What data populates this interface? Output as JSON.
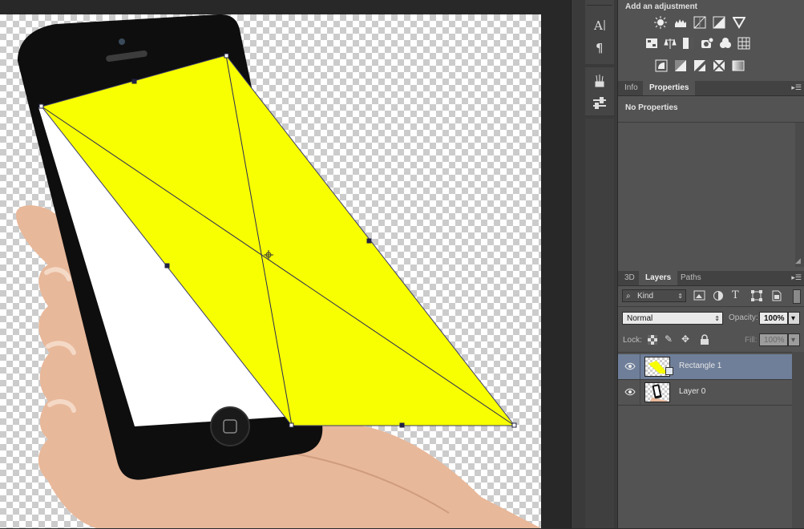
{
  "colors": {
    "shape_fill": "#f7ff00",
    "selection_row": "#6f7f9a",
    "panel_bg": "#535353"
  },
  "adjustments": {
    "header": "Add an adjustment",
    "icons": [
      "brightness-contrast-icon",
      "levels-icon",
      "curves-icon",
      "exposure-icon",
      "vibrance-icon",
      "hue-saturation-icon",
      "color-balance-icon",
      "black-white-icon",
      "photo-filter-icon",
      "channel-mixer-icon",
      "color-lookup-icon",
      "invert-icon",
      "posterize-icon",
      "threshold-icon",
      "selective-color-icon",
      "gradient-map-icon"
    ]
  },
  "properties_panel": {
    "tabs": [
      "Info",
      "Properties"
    ],
    "active_tab": "Properties",
    "empty_text": "No Properties"
  },
  "layers_panel": {
    "tabs": [
      "3D",
      "Layers",
      "Paths"
    ],
    "active_tab": "Layers",
    "filter_label": "Kind",
    "blend_mode": "Normal",
    "opacity_label": "Opacity:",
    "opacity_value": "100%",
    "lock_label": "Lock:",
    "fill_label": "Fill:",
    "fill_value": "100%",
    "layers": [
      {
        "name": "Rectangle 1",
        "selected": true,
        "visible": true
      },
      {
        "name": "Layer 0",
        "selected": false,
        "visible": true
      }
    ]
  },
  "tool_strip": {
    "icons": [
      "character-icon",
      "paragraph-icon",
      "brush-presets-icon",
      "tool-presets-icon"
    ]
  }
}
